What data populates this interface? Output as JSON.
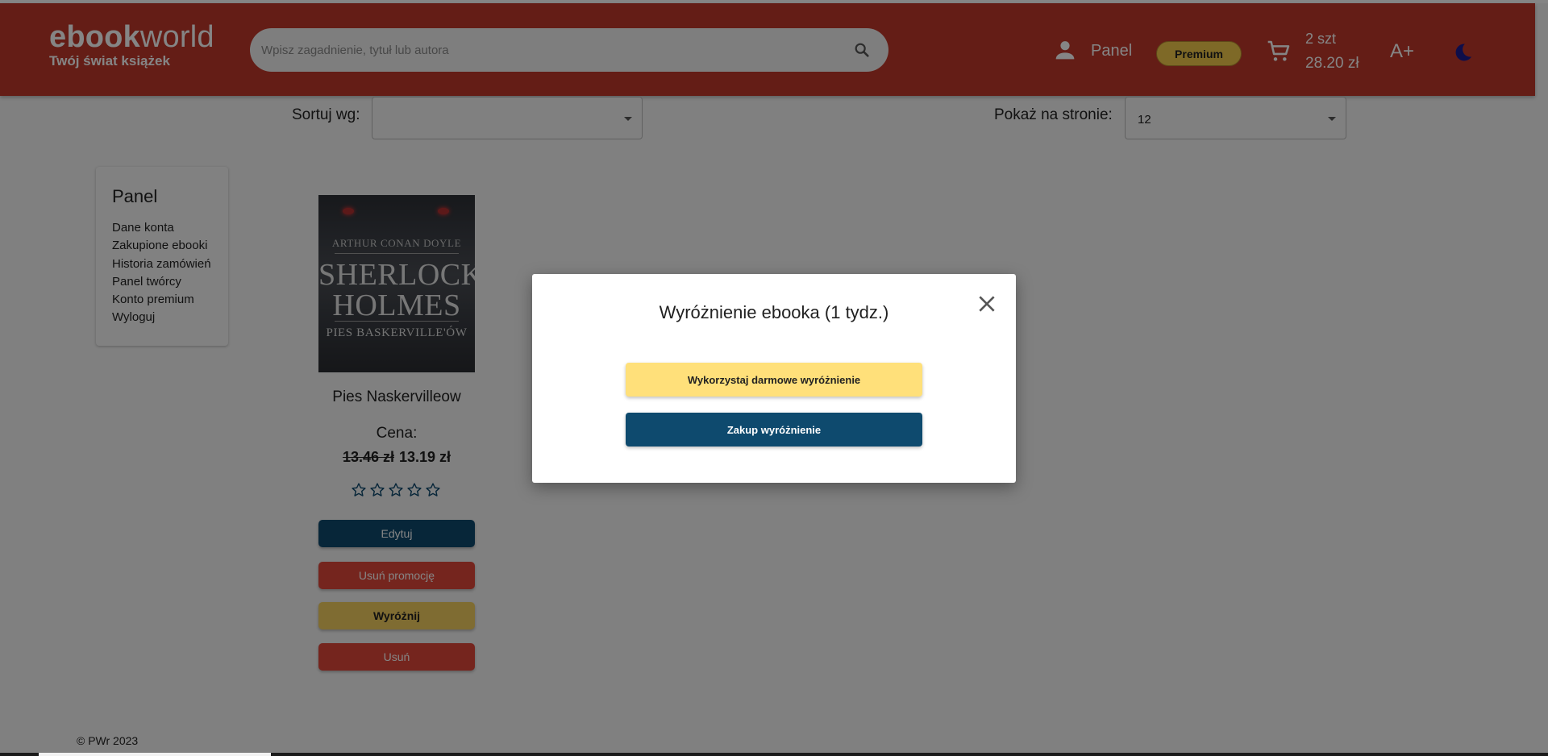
{
  "header": {
    "logo_bold": "ebook",
    "logo_light": "world",
    "logo_subtitle": "Twój świat książek",
    "search_placeholder": "Wpisz zagadnienie, tytuł lub autora",
    "panel_label": "Panel",
    "premium_label": "Premium",
    "cart_quantity": "2 szt",
    "cart_total": "28.20 zł",
    "font_size_label": "A+"
  },
  "filters": {
    "sort_label": "Sortuj wg:",
    "sort_value": "",
    "per_page_label": "Pokaż na stronie:",
    "per_page_value": "12"
  },
  "sidebar": {
    "title": "Panel",
    "items": [
      {
        "label": "Dane konta"
      },
      {
        "label": "Zakupione ebooki"
      },
      {
        "label": "Historia zamówień"
      },
      {
        "label": "Panel twórcy"
      },
      {
        "label": "Konto premium"
      },
      {
        "label": "Wyloguj"
      }
    ]
  },
  "book": {
    "cover_author": "ARTHUR CONAN DOYLE",
    "cover_title_line1": "SHERLOCK",
    "cover_title_line2": "HOLMES",
    "cover_subtitle": "PIES BASKERVILLE'ÓW",
    "title": "Pies Naskervilleow",
    "price_label": "Cena:",
    "old_price": "13.46 zł",
    "new_price": "13.19 zł",
    "rating": 0,
    "rating_max": 5,
    "buttons": {
      "edit": "Edytuj",
      "remove_promo": "Usuń promocję",
      "feature": "Wyróżnij",
      "delete": "Usuń"
    }
  },
  "footer": {
    "copyright": "© PWr 2023"
  },
  "modal": {
    "title": "Wyróżnienie ebooka (1 tydz.)",
    "free_button": "Wykorzystaj darmowe wyróżnienie",
    "buy_button": "Zakup wyróżnienie"
  },
  "colors": {
    "header_bg": "#c0392b",
    "primary_blue": "#0e4a6e",
    "danger_red": "#e0473a",
    "gold": "#f4cf60",
    "modal_yellow": "#ffe07a"
  }
}
